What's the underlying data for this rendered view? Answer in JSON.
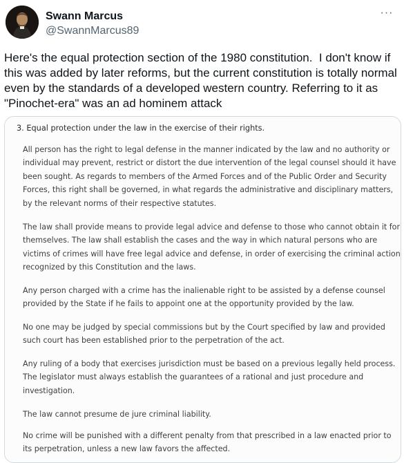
{
  "author": {
    "display_name": "Swann Marcus",
    "handle": "@SwannMarcus89",
    "avatar_icon": "portrait-avatar"
  },
  "more_menu": {
    "label": "···",
    "icon": "more-horizontal-icon"
  },
  "tweet": {
    "text": "Here's the equal protection section of the 1980 constitution.  I don't know if this was added by later reforms, but the current constitution is totally normal even by the standards of a developed western country. Referring to it as \"Pinochet-era\" was an ad hominem attack"
  },
  "document": {
    "heading": "3. Equal protection under the law in the exercise of their rights.",
    "paragraphs": [
      "All person has the right to legal defense in the manner indicated by the law and no authority or individual may prevent, restrict or distort the due intervention of the legal counsel should it have been sought. As regards to members of the Armed Forces and of the Public Order and Security Forces, this right shall be governed, in what regards the administrative and disciplinary matters, by the relevant norms of their respective statutes.",
      "The law shall provide means to provide legal advice and defense to those who cannot obtain it for themselves. The law shall establish the cases and the way in which natural persons who are victims of crimes will have free legal advice and defense, in order of exercising the criminal action recognized by this Constitution and the laws.",
      "Any person charged with a crime has the inalienable right to be assisted by a defense counsel provided by the State if he fails to appoint one at the opportunity provided by the law.",
      "No one may be judged by special commissions but by the Court specified by law and provided such court has been established prior to the perpetration of the act.",
      "Any ruling of a body that exercises jurisdiction must be based on a previous legally held process. The legislator must always establish the guarantees of a rational and just procedure and investigation.",
      "The law cannot presume de jure criminal liability.",
      "No crime will be punished with a different penalty from that prescribed in a law enacted prior to its perpetration, unless a new law favors the affected."
    ]
  }
}
